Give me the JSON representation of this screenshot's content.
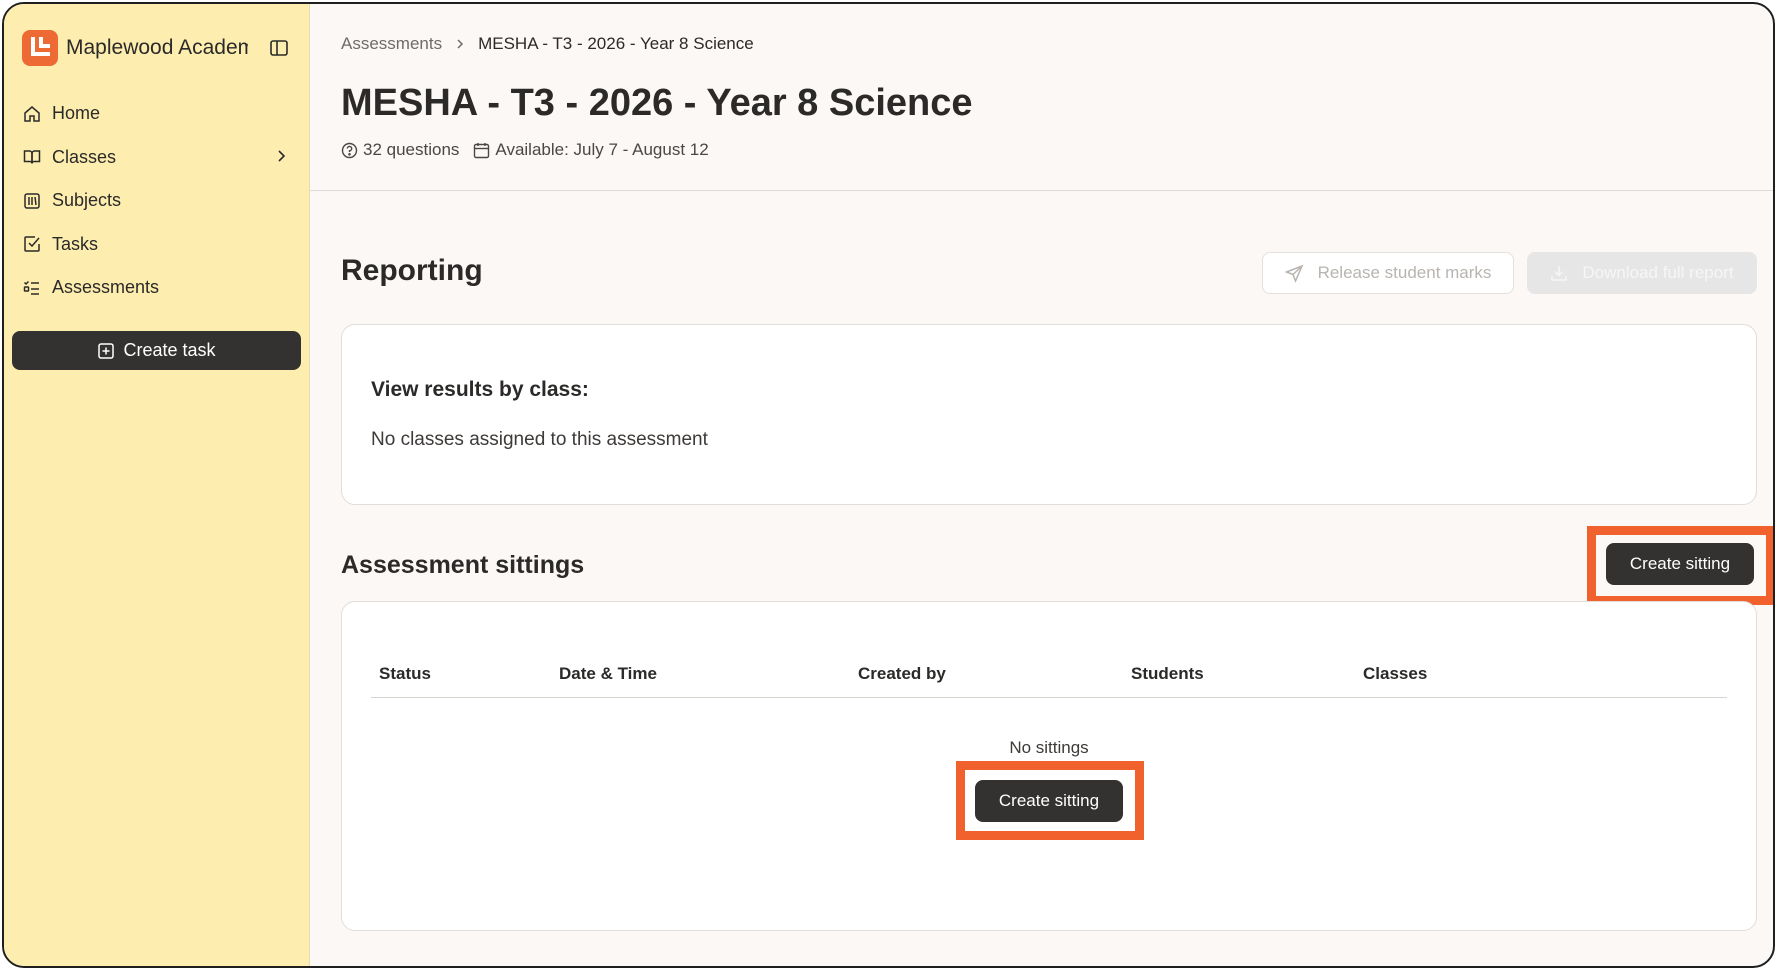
{
  "sidebar": {
    "brand_name": "Maplewood Academy",
    "items": [
      {
        "label": "Home",
        "icon": "home-icon"
      },
      {
        "label": "Classes",
        "icon": "book-icon"
      },
      {
        "label": "Subjects",
        "icon": "library-icon"
      },
      {
        "label": "Tasks",
        "icon": "checkbox-icon"
      },
      {
        "label": "Assessments",
        "icon": "list-check-icon"
      }
    ],
    "create_task_label": "Create task"
  },
  "header": {
    "breadcrumb": {
      "parent": "Assessments",
      "current": "MESHA - T3 - 2026 - Year 8 Science"
    },
    "title": "MESHA - T3 - 2026 - Year 8 Science",
    "questions": "32 questions",
    "availability": "Available: July 7 - August 12"
  },
  "reporting": {
    "title": "Reporting",
    "release_marks_label": "Release student marks",
    "download_report_label": "Download full report",
    "classes_heading": "View results by class:",
    "classes_empty": "No classes assigned to this assessment"
  },
  "sittings": {
    "title": "Assessment sittings",
    "create_label": "Create sitting",
    "columns": [
      "Status",
      "Date & Time",
      "Created by",
      "Students",
      "Classes"
    ],
    "empty_text": "No sittings",
    "empty_create_label": "Create sitting"
  },
  "colors": {
    "sidebar_bg": "#fdeeb0",
    "accent": "#ee6a35",
    "highlight": "#f0612d",
    "button_dark": "#343231"
  }
}
